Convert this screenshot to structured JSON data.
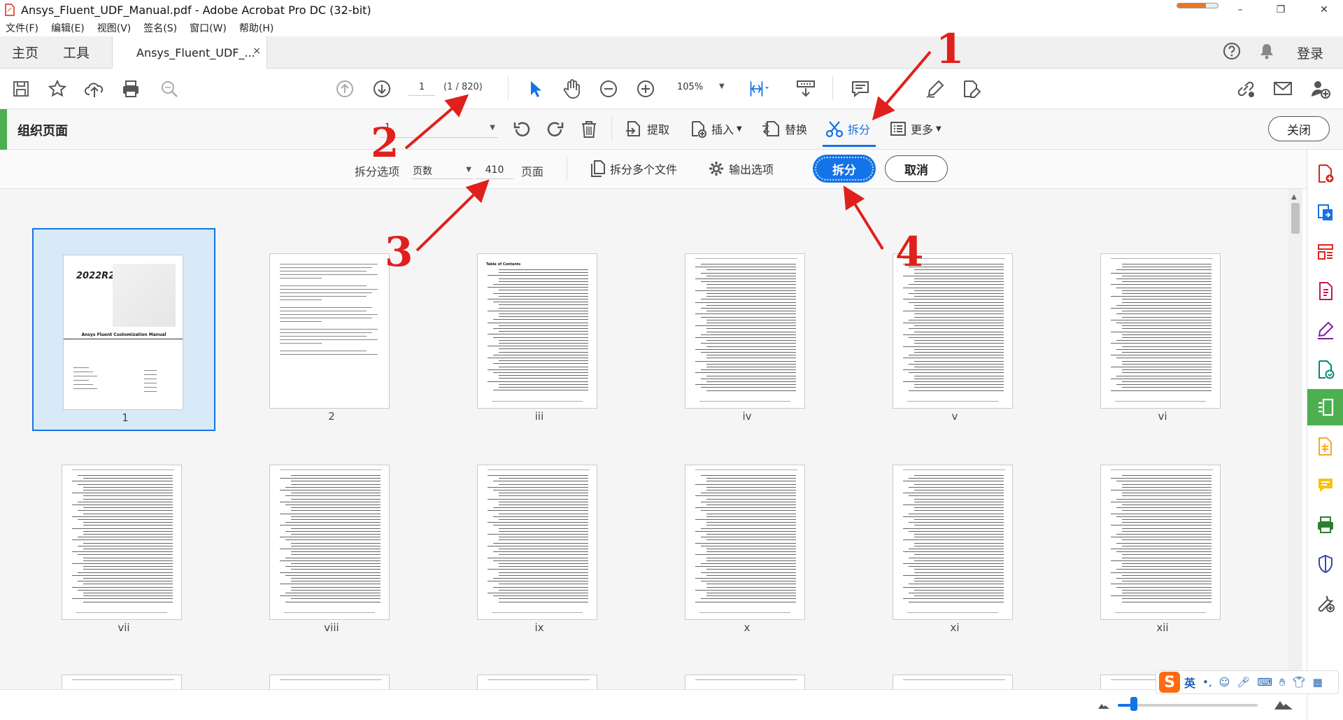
{
  "window": {
    "title": "Ansys_Fluent_UDF_Manual.pdf - Adobe Acrobat Pro DC (32-bit)",
    "minimize": "–",
    "maximize": "❐",
    "close": "✕"
  },
  "menu": [
    "文件(F)",
    "编辑(E)",
    "视图(V)",
    "签名(S)",
    "窗口(W)",
    "帮助(H)"
  ],
  "tabs": {
    "home": "主页",
    "tools": "工具",
    "document": "Ansys_Fluent_UDF_...",
    "close": "×",
    "login": "登录"
  },
  "toolbar": {
    "page_current": "1",
    "page_count": "(1 / 820)",
    "zoom": "105%"
  },
  "organize": {
    "title": "组织页面",
    "page_field": "1",
    "extract": "提取",
    "insert": "插入",
    "replace": "替换",
    "split": "拆分",
    "more": "更多",
    "close": "关闭"
  },
  "split_options": {
    "label": "拆分选项",
    "mode": "页数",
    "count": "410",
    "unit": "页面",
    "multiple_files": "拆分多个文件",
    "output_options": "输出选项",
    "split_button": "拆分",
    "cancel_button": "取消"
  },
  "thumbnails": [
    {
      "label": "1",
      "kind": "cover",
      "cover_text": "Ansys Fluent Customization Manual",
      "badge": "2022R2"
    },
    {
      "label": "2",
      "kind": "text"
    },
    {
      "label": "iii",
      "kind": "toc",
      "heading": "Table of Contents"
    },
    {
      "label": "iv",
      "kind": "toc"
    },
    {
      "label": "v",
      "kind": "toc"
    },
    {
      "label": "vi",
      "kind": "toc"
    },
    {
      "label": "vii",
      "kind": "toc"
    },
    {
      "label": "viii",
      "kind": "toc"
    },
    {
      "label": "ix",
      "kind": "toc"
    },
    {
      "label": "x",
      "kind": "toc"
    },
    {
      "label": "xi",
      "kind": "toc"
    },
    {
      "label": "xii",
      "kind": "toc"
    }
  ],
  "ime": {
    "logo": "S",
    "lang": "英"
  },
  "annotations": [
    "1",
    "2",
    "3",
    "4"
  ],
  "colors": {
    "accent_blue": "#1473e6",
    "accent_green": "#4caf50",
    "annotation_red": "#e0201c"
  }
}
